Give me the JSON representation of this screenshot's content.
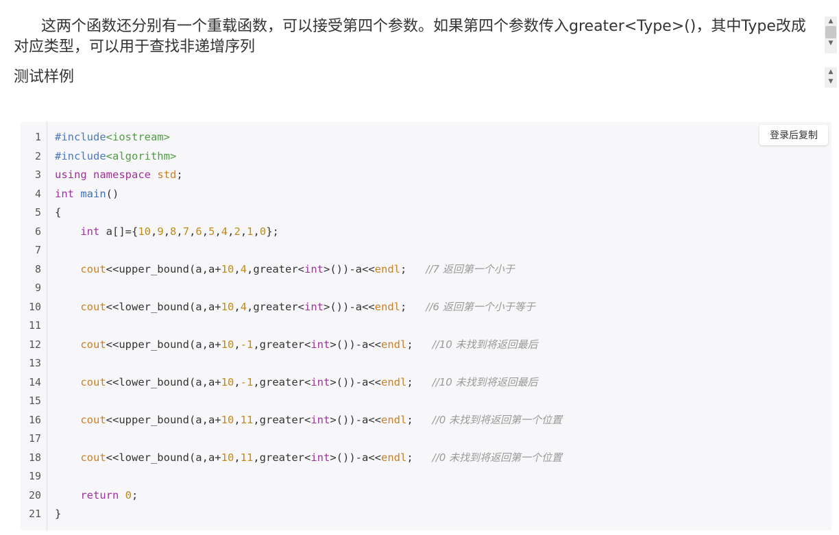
{
  "article": {
    "paragraph": "这两个函数还分别有一个重载函数，可以接受第四个参数。如果第四个参数传入greater<Type>()，其中Type改成对应类型，可以用于查找非递增序列",
    "heading": "测试样例"
  },
  "code_block": {
    "copy_button_label": "登录后复制",
    "line_numbers": [
      "1",
      "2",
      "3",
      "4",
      "5",
      "6",
      "7",
      "8",
      "9",
      "10",
      "11",
      "12",
      "13",
      "14",
      "15",
      "16",
      "17",
      "18",
      "19",
      "20",
      "21"
    ],
    "lines": [
      [
        [
          "pp",
          "#include"
        ],
        [
          "str",
          "<iostream>"
        ]
      ],
      [
        [
          "pp",
          "#include"
        ],
        [
          "str",
          "<algorithm>"
        ]
      ],
      [
        [
          "kw",
          "using"
        ],
        [
          "txt",
          " "
        ],
        [
          "kw",
          "namespace"
        ],
        [
          "txt",
          " "
        ],
        [
          "out",
          "std"
        ],
        [
          "txt",
          ";"
        ]
      ],
      [
        [
          "type",
          "int"
        ],
        [
          "txt",
          " "
        ],
        [
          "fn",
          "main"
        ],
        [
          "txt",
          "()"
        ]
      ],
      [
        [
          "txt",
          "{"
        ]
      ],
      [
        [
          "txt",
          "    "
        ],
        [
          "type",
          "int"
        ],
        [
          "txt",
          " a[]={"
        ],
        [
          "num",
          "10"
        ],
        [
          "txt",
          ","
        ],
        [
          "num",
          "9"
        ],
        [
          "txt",
          ","
        ],
        [
          "num",
          "8"
        ],
        [
          "txt",
          ","
        ],
        [
          "num",
          "7"
        ],
        [
          "txt",
          ","
        ],
        [
          "num",
          "6"
        ],
        [
          "txt",
          ","
        ],
        [
          "num",
          "5"
        ],
        [
          "txt",
          ","
        ],
        [
          "num",
          "4"
        ],
        [
          "txt",
          ","
        ],
        [
          "num",
          "2"
        ],
        [
          "txt",
          ","
        ],
        [
          "num",
          "1"
        ],
        [
          "txt",
          ","
        ],
        [
          "num",
          "0"
        ],
        [
          "txt",
          "};"
        ]
      ],
      [],
      [
        [
          "txt",
          "    "
        ],
        [
          "out",
          "cout"
        ],
        [
          "txt",
          "<<upper_bound(a,a+"
        ],
        [
          "num",
          "10"
        ],
        [
          "txt",
          ","
        ],
        [
          "num",
          "4"
        ],
        [
          "txt",
          ",greater<"
        ],
        [
          "type",
          "int"
        ],
        [
          "txt",
          ">())-a<<"
        ],
        [
          "out",
          "endl"
        ],
        [
          "txt",
          ";   "
        ],
        [
          "cm",
          "//7 返回第一个小于"
        ]
      ],
      [],
      [
        [
          "txt",
          "    "
        ],
        [
          "out",
          "cout"
        ],
        [
          "txt",
          "<<lower_bound(a,a+"
        ],
        [
          "num",
          "10"
        ],
        [
          "txt",
          ","
        ],
        [
          "num",
          "4"
        ],
        [
          "txt",
          ",greater<"
        ],
        [
          "type",
          "int"
        ],
        [
          "txt",
          ">())-a<<"
        ],
        [
          "out",
          "endl"
        ],
        [
          "txt",
          ";   "
        ],
        [
          "cm",
          "//6 返回第一个小于等于"
        ]
      ],
      [],
      [
        [
          "txt",
          "    "
        ],
        [
          "out",
          "cout"
        ],
        [
          "txt",
          "<<upper_bound(a,a+"
        ],
        [
          "num",
          "10"
        ],
        [
          "txt",
          ","
        ],
        [
          "num",
          "-1"
        ],
        [
          "txt",
          ",greater<"
        ],
        [
          "type",
          "int"
        ],
        [
          "txt",
          ">())-a<<"
        ],
        [
          "out",
          "endl"
        ],
        [
          "txt",
          ";   "
        ],
        [
          "cm",
          "//10 未找到将返回最后"
        ]
      ],
      [],
      [
        [
          "txt",
          "    "
        ],
        [
          "out",
          "cout"
        ],
        [
          "txt",
          "<<lower_bound(a,a+"
        ],
        [
          "num",
          "10"
        ],
        [
          "txt",
          ","
        ],
        [
          "num",
          "-1"
        ],
        [
          "txt",
          ",greater<"
        ],
        [
          "type",
          "int"
        ],
        [
          "txt",
          ">())-a<<"
        ],
        [
          "out",
          "endl"
        ],
        [
          "txt",
          ";   "
        ],
        [
          "cm",
          "//10 未找到将返回最后"
        ]
      ],
      [],
      [
        [
          "txt",
          "    "
        ],
        [
          "out",
          "cout"
        ],
        [
          "txt",
          "<<upper_bound(a,a+"
        ],
        [
          "num",
          "10"
        ],
        [
          "txt",
          ","
        ],
        [
          "num",
          "11"
        ],
        [
          "txt",
          ",greater<"
        ],
        [
          "type",
          "int"
        ],
        [
          "txt",
          ">())-a<<"
        ],
        [
          "out",
          "endl"
        ],
        [
          "txt",
          ";   "
        ],
        [
          "cm",
          "//0 未找到将返回第一个位置"
        ]
      ],
      [],
      [
        [
          "txt",
          "    "
        ],
        [
          "out",
          "cout"
        ],
        [
          "txt",
          "<<lower_bound(a,a+"
        ],
        [
          "num",
          "10"
        ],
        [
          "txt",
          ","
        ],
        [
          "num",
          "11"
        ],
        [
          "txt",
          ",greater<"
        ],
        [
          "type",
          "int"
        ],
        [
          "txt",
          ">())-a<<"
        ],
        [
          "out",
          "endl"
        ],
        [
          "txt",
          ";   "
        ],
        [
          "cm",
          "//0 未找到将返回第一个位置"
        ]
      ],
      [],
      [
        [
          "txt",
          "    "
        ],
        [
          "kw",
          "return"
        ],
        [
          "txt",
          " "
        ],
        [
          "num",
          "0"
        ],
        [
          "txt",
          ";"
        ]
      ],
      [
        [
          "txt",
          "}"
        ]
      ]
    ]
  },
  "icons": {
    "scroll_up": "chevron-up-icon",
    "scroll_down": "chevron-down-icon"
  }
}
